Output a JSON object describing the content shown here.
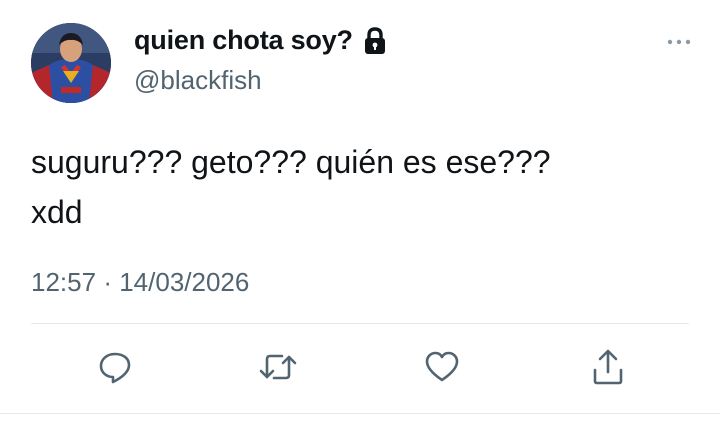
{
  "user": {
    "display_name": "quien chota soy?",
    "handle": "@blackfish",
    "protected": true
  },
  "tweet": {
    "text_lines": [
      "suguru??? geto??? quién es ese???",
      "xdd"
    ],
    "time": "12:57",
    "separator": "·",
    "date": "14/03/2026"
  },
  "actions": {
    "icons": [
      "reply-icon",
      "retweet-icon",
      "like-icon",
      "share-icon"
    ]
  },
  "colors": {
    "text": "#0f1419",
    "secondary": "#536471",
    "divider": "#e6e9ec"
  }
}
